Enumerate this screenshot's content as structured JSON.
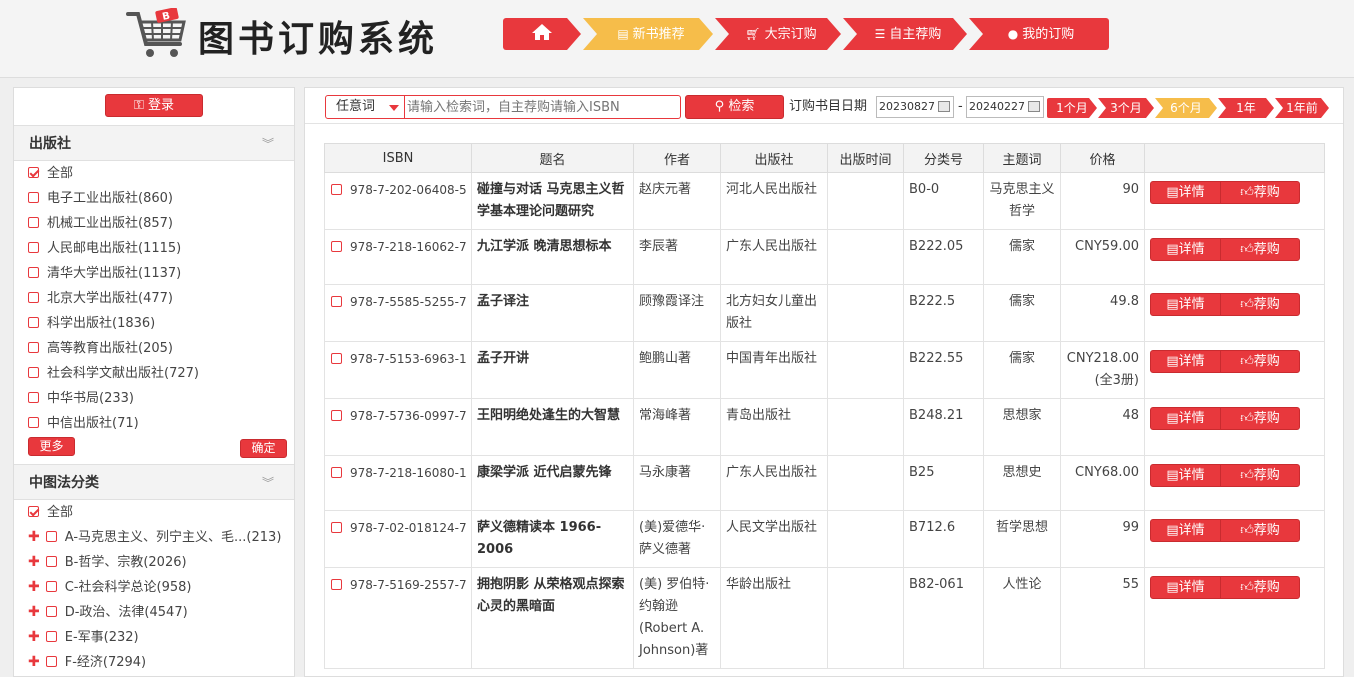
{
  "header": {
    "logo_text": "图书订购系统",
    "nav": [
      {
        "label": "",
        "icon": "home-icon"
      },
      {
        "label": "新书推荐",
        "icon": "book-icon"
      },
      {
        "label": "大宗订购",
        "icon": "cart-icon"
      },
      {
        "label": "自主荐购",
        "icon": "list-icon"
      },
      {
        "label": "我的订购",
        "icon": "user-icon"
      }
    ]
  },
  "sidebar": {
    "login_label": "登录",
    "publisher": {
      "title": "出版社",
      "all_label": "全部",
      "items": [
        "电子工业出版社(860)",
        "机械工业出版社(857)",
        "人民邮电出版社(1115)",
        "清华大学出版社(1137)",
        "北京大学出版社(477)",
        "科学出版社(1836)",
        "高等教育出版社(205)",
        "社会科学文献出版社(727)",
        "中华书局(233)",
        "中信出版社(71)"
      ],
      "more_label": "更多",
      "ok_label": "确定"
    },
    "clc": {
      "title": "中图法分类",
      "all_label": "全部",
      "items": [
        "A-马克思主义、列宁主义、毛...(213)",
        "B-哲学、宗教(2026)",
        "C-社会科学总论(958)",
        "D-政治、法律(4547)",
        "E-军事(232)",
        "F-经济(7294)"
      ]
    }
  },
  "toolbar": {
    "select_value": "任意词",
    "search_placeholder": "请输入检索词，自主荐购请输入ISBN",
    "search_label": "检索",
    "date_label": "订购书目日期",
    "date_from": "20230827",
    "date_sep": "-",
    "date_to": "20240227",
    "ranges": [
      "1个月",
      "3个月",
      "6个月",
      "1年",
      "1年前"
    ],
    "active_range": "6个月"
  },
  "table": {
    "columns": [
      "ISBN",
      "题名",
      "作者",
      "出版社",
      "出版时间",
      "分类号",
      "主题词",
      "价格",
      ""
    ],
    "detail_label": "详情",
    "recommend_label": "荐购",
    "rows": [
      {
        "isbn": "978-7-202-06408-5",
        "title": "碰撞与对话 马克思主义哲学基本理论问题研究",
        "author": "赵庆元著",
        "publisher": "河北人民出版社",
        "date": "",
        "class": "B0-0",
        "subject": "马克思主义哲学",
        "price": "90"
      },
      {
        "isbn": "978-7-218-16062-7",
        "title": "九江学派 晚清思想标本",
        "author": "李辰著",
        "publisher": "广东人民出版社",
        "date": "",
        "class": "B222.05",
        "subject": "儒家",
        "price": "CNY59.00"
      },
      {
        "isbn": "978-7-5585-5255-7",
        "title": "孟子译注",
        "author": "顾豫霞译注",
        "publisher": "北方妇女儿童出版社",
        "date": "",
        "class": "B222.5",
        "subject": "儒家",
        "price": "49.8"
      },
      {
        "isbn": "978-7-5153-6963-1",
        "title": "孟子开讲",
        "author": "鲍鹏山著",
        "publisher": "中国青年出版社",
        "date": "",
        "class": "B222.55",
        "subject": "儒家",
        "price": "CNY218.00 (全3册)"
      },
      {
        "isbn": "978-7-5736-0997-7",
        "title": "王阳明绝处逢生的大智慧",
        "author": "常海峰著",
        "publisher": "青岛出版社",
        "date": "",
        "class": "B248.21",
        "subject": "思想家",
        "price": "48"
      },
      {
        "isbn": "978-7-218-16080-1",
        "title": "康梁学派 近代启蒙先锋",
        "author": "马永康著",
        "publisher": "广东人民出版社",
        "date": "",
        "class": "B25",
        "subject": "思想史",
        "price": "CNY68.00"
      },
      {
        "isbn": "978-7-02-018124-7",
        "title": "萨义德精读本 1966-2006",
        "author": "(美)爱德华·萨义德著",
        "publisher": "人民文学出版社",
        "date": "",
        "class": "B712.6",
        "subject": "哲学思想",
        "price": "99"
      },
      {
        "isbn": "978-7-5169-2557-7",
        "title": "拥抱阴影 从荣格观点探索心灵的黑暗面",
        "author": "(美) 罗伯特·约翰逊(Robert A. Johnson)著",
        "publisher": "华龄出版社",
        "date": "",
        "class": "B82-061",
        "subject": "人性论",
        "price": "55"
      }
    ]
  },
  "colors": {
    "accent": "#e8383d",
    "active": "#f6bd4a"
  }
}
